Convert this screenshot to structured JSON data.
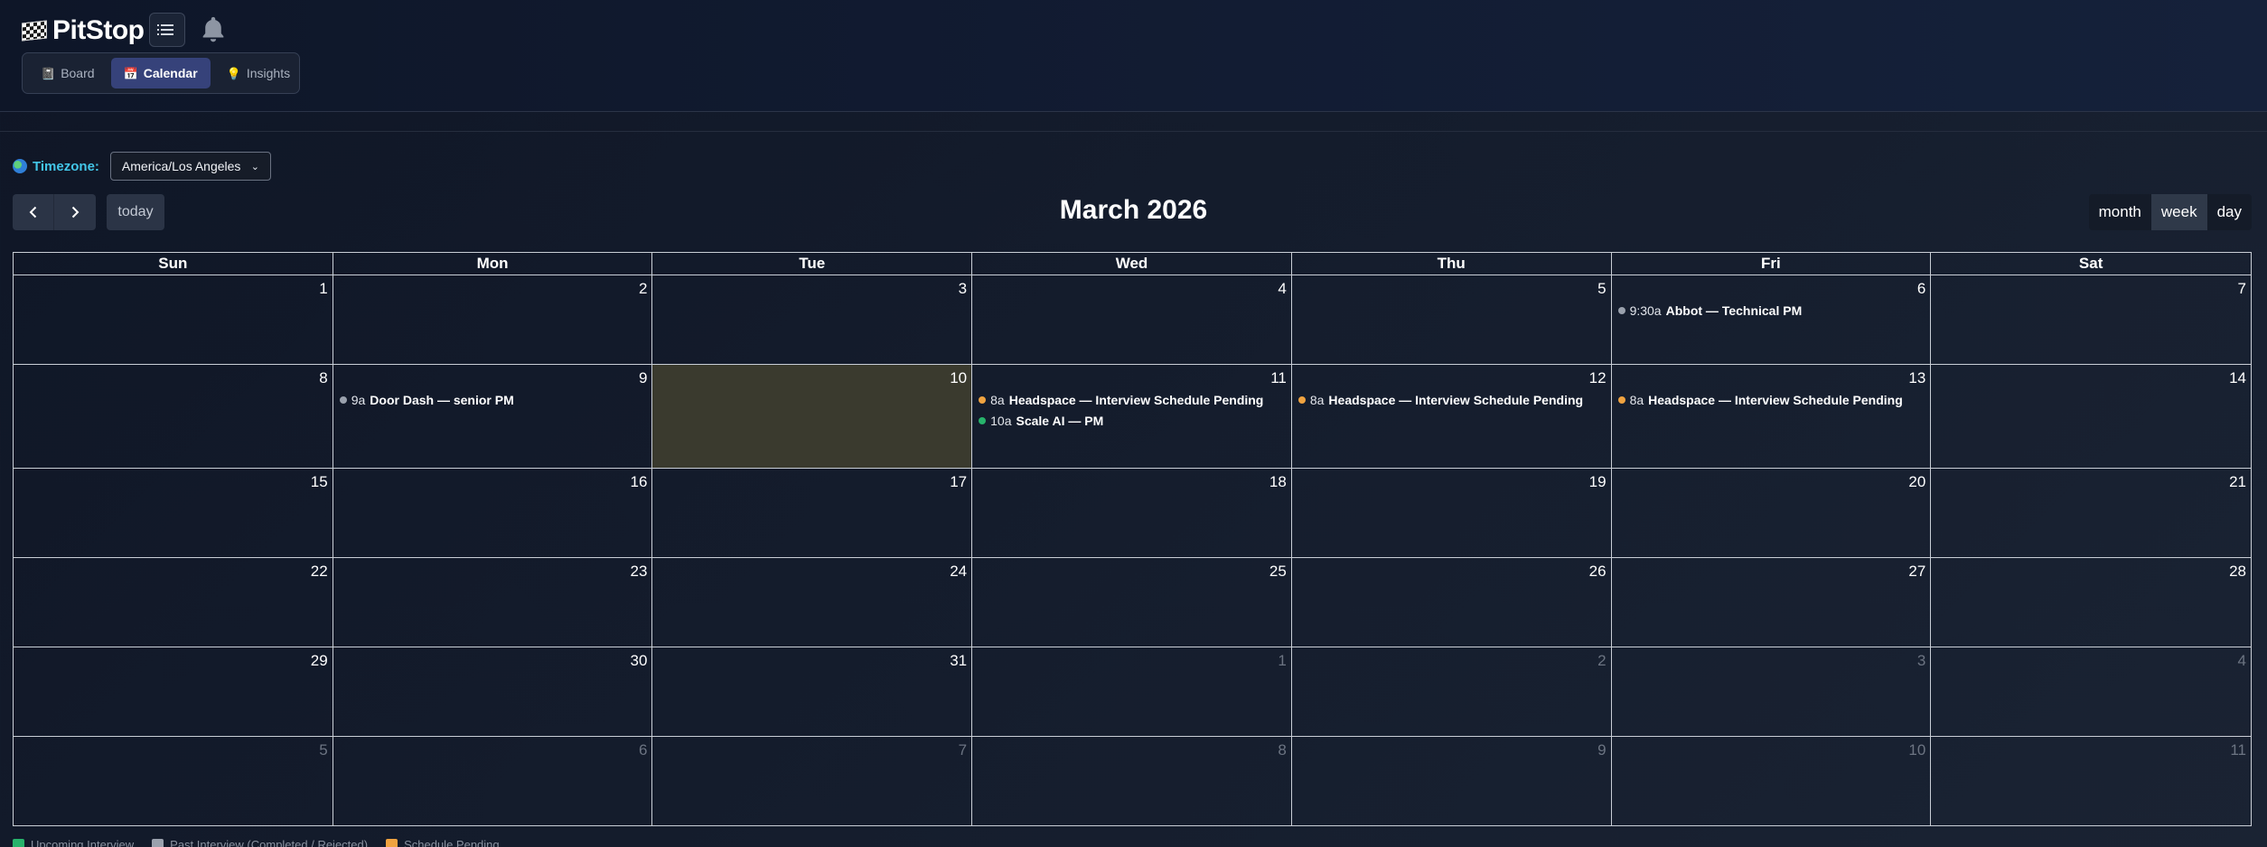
{
  "app": {
    "brand": "PitStop"
  },
  "nav": {
    "tabs": [
      {
        "label": "Board",
        "icon": "notebook-icon",
        "active": false
      },
      {
        "label": "Calendar",
        "icon": "calendar-icon",
        "active": true
      },
      {
        "label": "Insights",
        "icon": "lightbulb-icon",
        "active": false
      }
    ]
  },
  "timezone": {
    "label": "Timezone:",
    "selected": "America/Los Angeles"
  },
  "toolbar": {
    "title": "March 2026",
    "today_label": "today",
    "views": [
      {
        "label": "month",
        "active": false
      },
      {
        "label": "week",
        "active": true
      },
      {
        "label": "day",
        "active": false
      }
    ]
  },
  "calendar": {
    "weekdays": [
      "Sun",
      "Mon",
      "Tue",
      "Wed",
      "Thu",
      "Fri",
      "Sat"
    ],
    "weeks": [
      [
        {
          "day": "1"
        },
        {
          "day": "2"
        },
        {
          "day": "3"
        },
        {
          "day": "4"
        },
        {
          "day": "5"
        },
        {
          "day": "6",
          "events": [
            {
              "time": "9:30a",
              "title": "Abbot — Technical PM",
              "status": "past"
            }
          ]
        },
        {
          "day": "7"
        }
      ],
      [
        {
          "day": "8"
        },
        {
          "day": "9",
          "events": [
            {
              "time": "9a",
              "title": "Door Dash — senior PM",
              "status": "past"
            }
          ]
        },
        {
          "day": "10",
          "today": true
        },
        {
          "day": "11",
          "events": [
            {
              "time": "8a",
              "title": "Headspace — Interview Schedule Pending",
              "status": "pending"
            },
            {
              "time": "10a",
              "title": "Scale AI — PM",
              "status": "upcoming"
            }
          ]
        },
        {
          "day": "12",
          "events": [
            {
              "time": "8a",
              "title": "Headspace — Interview Schedule Pending",
              "status": "pending"
            }
          ]
        },
        {
          "day": "13",
          "events": [
            {
              "time": "8a",
              "title": "Headspace — Interview Schedule Pending",
              "status": "pending"
            }
          ]
        },
        {
          "day": "14"
        }
      ],
      [
        {
          "day": "15"
        },
        {
          "day": "16"
        },
        {
          "day": "17"
        },
        {
          "day": "18"
        },
        {
          "day": "19"
        },
        {
          "day": "20"
        },
        {
          "day": "21"
        }
      ],
      [
        {
          "day": "22"
        },
        {
          "day": "23"
        },
        {
          "day": "24"
        },
        {
          "day": "25"
        },
        {
          "day": "26"
        },
        {
          "day": "27"
        },
        {
          "day": "28"
        }
      ],
      [
        {
          "day": "29"
        },
        {
          "day": "30"
        },
        {
          "day": "31"
        },
        {
          "day": "1",
          "other": true
        },
        {
          "day": "2",
          "other": true
        },
        {
          "day": "3",
          "other": true
        },
        {
          "day": "4",
          "other": true
        }
      ],
      [
        {
          "day": "5",
          "other": true
        },
        {
          "day": "6",
          "other": true
        },
        {
          "day": "7",
          "other": true
        },
        {
          "day": "8",
          "other": true
        },
        {
          "day": "9",
          "other": true
        },
        {
          "day": "10",
          "other": true
        },
        {
          "day": "11",
          "other": true
        }
      ]
    ]
  },
  "legend": [
    {
      "label": "Upcoming Interview",
      "status": "upcoming"
    },
    {
      "label": "Past Interview (Completed / Rejected)",
      "status": "past"
    },
    {
      "label": "Schedule Pending",
      "status": "pending"
    }
  ],
  "colors": {
    "upcoming": "#27b36b",
    "past": "#9aa1ad",
    "pending": "#f0a340",
    "today_bg": "#3a3a2e",
    "accent": "#36427a"
  }
}
